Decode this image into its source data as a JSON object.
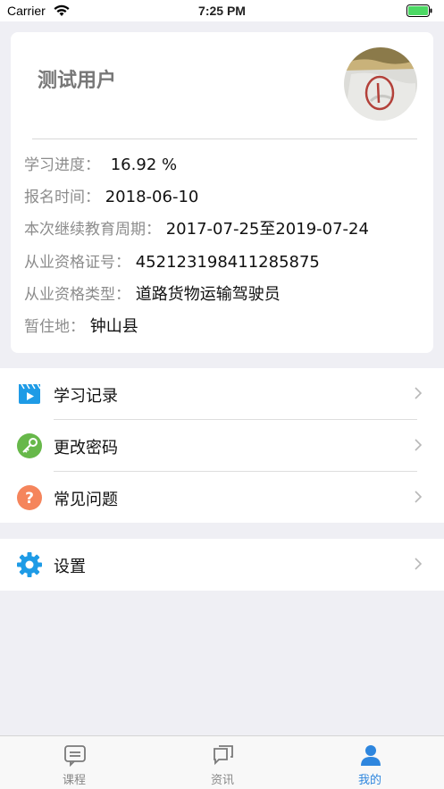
{
  "status_bar": {
    "carrier": "Carrier",
    "time": "7:25 PM"
  },
  "profile": {
    "name": "测试用户",
    "rows": [
      {
        "label": "学习进度：",
        "value": "16.92 %"
      },
      {
        "label": "报名时间：",
        "value": "2018-06-10"
      },
      {
        "label": "本次继续教育周期：",
        "value": "2017-07-25至2019-07-24"
      },
      {
        "label": "从业资格证号：",
        "value": "452123198411285875"
      },
      {
        "label": "从业资格类型：",
        "value": "道路货物运输驾驶员"
      },
      {
        "label": "暂住地：",
        "value": "钟山县"
      }
    ]
  },
  "menu": {
    "items": [
      {
        "label": "学习记录",
        "icon": "video-play-icon",
        "color": "#1e9be6"
      },
      {
        "label": "更改密码",
        "icon": "key-icon",
        "color": "#67b84a"
      },
      {
        "label": "常见问题",
        "icon": "question-icon",
        "color": "#f5855c"
      }
    ],
    "settings": {
      "label": "设置",
      "icon": "gear-icon",
      "color": "#1e9be6"
    }
  },
  "tabbar": {
    "tabs": [
      {
        "label": "课程",
        "icon": "course-icon"
      },
      {
        "label": "资讯",
        "icon": "news-icon"
      },
      {
        "label": "我的",
        "icon": "profile-icon"
      }
    ],
    "active_color": "#2e86de",
    "inactive_color": "#888888"
  }
}
